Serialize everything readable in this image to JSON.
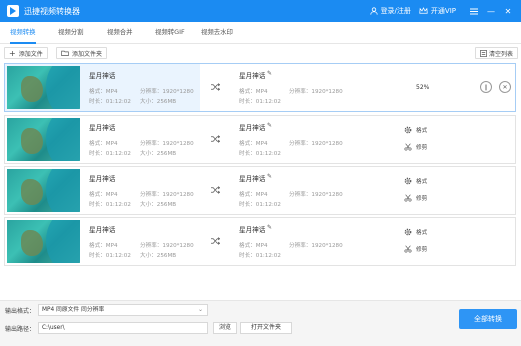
{
  "app": {
    "title": "迅捷视频转换器",
    "brand_color": "#1b8bf2"
  },
  "titlebar": {
    "login": "登录/注册",
    "vip": "开通VIP",
    "menu_icon": "menu-icon",
    "min": "—",
    "close": "✕"
  },
  "tabs": [
    {
      "label": "视频转换",
      "active": true
    },
    {
      "label": "视频分割",
      "active": false
    },
    {
      "label": "视频合并",
      "active": false
    },
    {
      "label": "视频转GIF",
      "active": false
    },
    {
      "label": "视频去水印",
      "active": false
    }
  ],
  "toolbar": {
    "add_file": "添加文件",
    "add_folder": "添加文件夹",
    "clear_list": "清空列表"
  },
  "files": [
    {
      "name": "星月神话",
      "format_label": "格式：",
      "format": "MP4",
      "res_label": "分辨率：",
      "res": "1920*1280",
      "dur_label": "时长：",
      "dur": "01:12:02",
      "size_label": "大小：",
      "size": "256MB",
      "out_name": "星月神话",
      "out_format": "MP4",
      "out_res": "1920*1280",
      "out_dur": "01:12:02",
      "progress": "52%",
      "state": "converting"
    },
    {
      "name": "星月神话",
      "format_label": "格式：",
      "format": "MP4",
      "res_label": "分辨率：",
      "res": "1920*1280",
      "dur_label": "时长：",
      "dur": "01:12:02",
      "size_label": "大小：",
      "size": "256MB",
      "out_name": "星月神话",
      "out_format": "MP4",
      "out_res": "1920*1280",
      "out_dur": "01:12:02",
      "action1": "格式",
      "action2": "修剪",
      "state": "idle"
    },
    {
      "name": "星月神话",
      "format_label": "格式：",
      "format": "MP4",
      "res_label": "分辨率：",
      "res": "1920*1280",
      "dur_label": "时长：",
      "dur": "01:12:02",
      "size_label": "大小：",
      "size": "256MB",
      "out_name": "星月神话",
      "out_format": "MP4",
      "out_res": "1920*1280",
      "out_dur": "01:12:02",
      "action1": "格式",
      "action2": "修剪",
      "state": "idle"
    },
    {
      "name": "星月神话",
      "format_label": "格式：",
      "format": "MP4",
      "res_label": "分辨率：",
      "res": "1920*1280",
      "dur_label": "时长：",
      "dur": "01:12:02",
      "size_label": "大小：",
      "size": "256MB",
      "out_name": "星月神话",
      "out_format": "MP4",
      "out_res": "1920*1280",
      "out_dur": "01:12:02",
      "action1": "格式",
      "action2": "修剪",
      "state": "idle"
    }
  ],
  "bottom": {
    "format_label": "输出格式：",
    "format_value": "MP4  同原文件  同分辨率",
    "path_label": "输出路径：",
    "path_value": "C:\\user\\",
    "browse": "浏览",
    "open_folder": "打开文件夹",
    "convert_all": "全部转换"
  }
}
